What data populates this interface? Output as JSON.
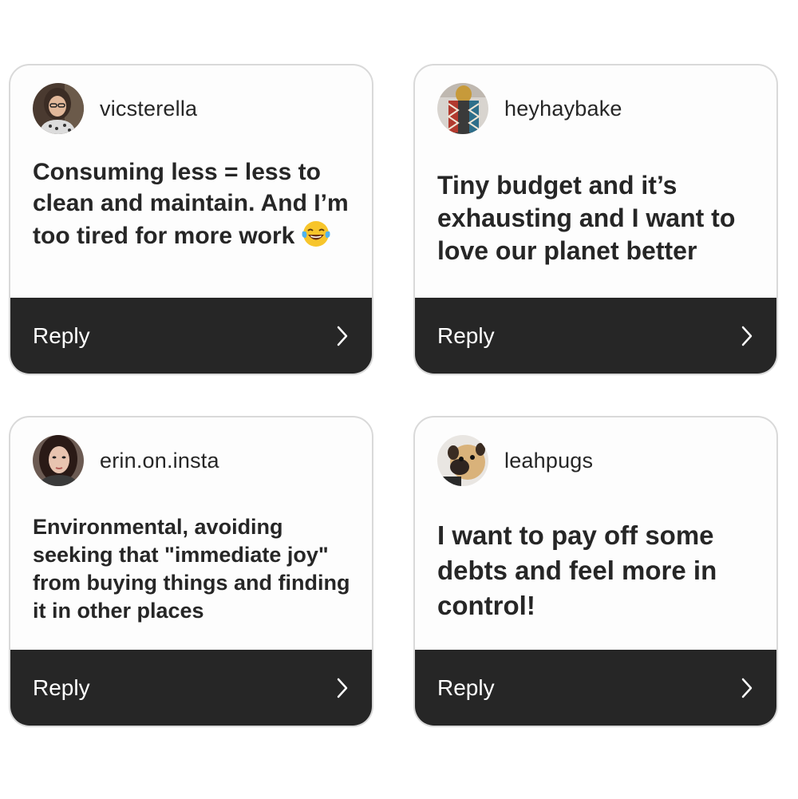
{
  "cards": [
    {
      "username": "vicsterella",
      "message": "Consuming less = less to clean and maintain. And I’m too tired for more work",
      "emoji": "laughing-tears-emoji",
      "reply_label": "Reply"
    },
    {
      "username": "heyhaybake",
      "message": "Tiny budget and it’s exhausting and I want to love our planet better",
      "reply_label": "Reply"
    },
    {
      "username": "erin.on.insta",
      "message": "Environmental, avoiding seeking that \"immediate joy\" from buying things and finding it in other places",
      "reply_label": "Reply"
    },
    {
      "username": "leahpugs",
      "message": "I want to pay off some debts and feel more in control!",
      "reply_label": "Reply"
    }
  ],
  "colors": {
    "card_background": "#fdfdfd",
    "card_border": "#d9d9d9",
    "reply_bar": "#262626",
    "text": "#262626"
  },
  "icons": {
    "reply_chevron": "chevron-right-icon",
    "avatar": "avatar"
  }
}
